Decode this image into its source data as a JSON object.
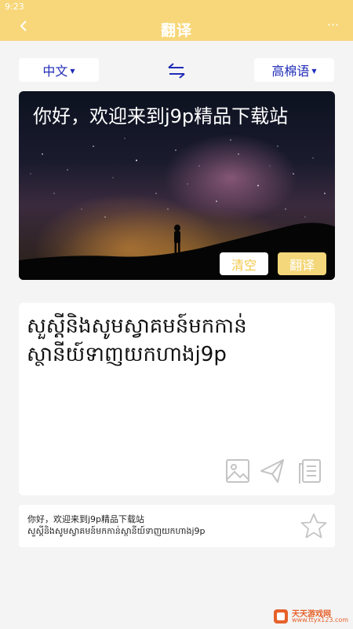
{
  "status_bar": {
    "time": "9:23"
  },
  "app_bar": {
    "title": "翻译",
    "more_label": "···"
  },
  "languages": {
    "source": "中文",
    "target": "高棉语"
  },
  "input": {
    "text": "你好，欢迎来到j9p精品下载站"
  },
  "buttons": {
    "clear": "清空",
    "translate": "翻译"
  },
  "result": {
    "text": "សួស្តីនិងសូមស្វាគមន៍មកកាន់ស្ថានីយ៍ទាញយកហាងj9p"
  },
  "history": {
    "source": "你好，欢迎来到j9p精品下载站",
    "translation": "សួស្តីនិងសូមស្វាគមន៍មកកាន់ស្ថានីយ៍ទាញយកហាងj9p"
  },
  "watermark": {
    "title": "天天游戏网",
    "url": "www.ttyx123.com"
  },
  "colors": {
    "accent": "#f7d77a",
    "language_text": "#1f2bb8",
    "clear_text": "#f2c84b",
    "icon_gray": "#c4c4c4"
  }
}
